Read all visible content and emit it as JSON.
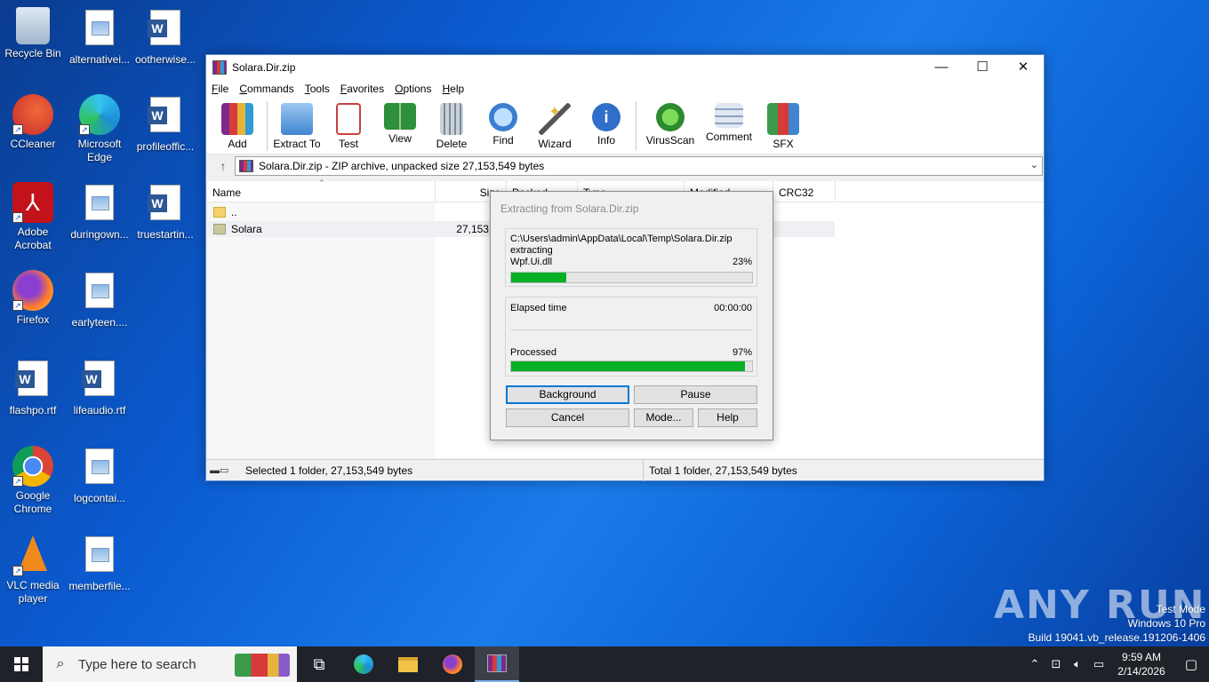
{
  "desktop": {
    "icons": [
      {
        "label": "Recycle Bin"
      },
      {
        "label": "alternativei..."
      },
      {
        "label": "ootherwise..."
      },
      {
        "label": "CCleaner"
      },
      {
        "label": "Microsoft Edge"
      },
      {
        "label": "profileoffic..."
      },
      {
        "label": "Adobe Acrobat"
      },
      {
        "label": "duringown..."
      },
      {
        "label": "truestartin..."
      },
      {
        "label": "Firefox"
      },
      {
        "label": "earlyteen...."
      },
      {
        "label": "flashpo.rtf"
      },
      {
        "label": "lifeaudio.rtf"
      },
      {
        "label": "Google Chrome"
      },
      {
        "label": "logcontai..."
      },
      {
        "label": "VLC media player"
      },
      {
        "label": "memberfile..."
      }
    ]
  },
  "window": {
    "title": "Solara.Dir.zip",
    "controls": {
      "minimize": "—",
      "maximize": "☐",
      "close": "✕"
    },
    "menu": [
      "File",
      "Commands",
      "Tools",
      "Favorites",
      "Options",
      "Help"
    ],
    "toolbar": [
      {
        "label": "Add",
        "icon": "add-archive-icon",
        "color": "#c23b3b"
      },
      {
        "label": "Extract To",
        "icon": "extract-folder-icon",
        "color": "#4a90d9"
      },
      {
        "label": "Test",
        "icon": "test-clipboard-icon",
        "color": "#d04040"
      },
      {
        "label": "View",
        "icon": "view-book-icon",
        "color": "#2f8f3a"
      },
      {
        "label": "Delete",
        "icon": "trash-icon",
        "color": "#7d8a96"
      },
      {
        "label": "Find",
        "icon": "magnifier-icon",
        "color": "#3a7fcf"
      },
      {
        "label": "Wizard",
        "icon": "wand-icon",
        "color": "#9b59b6"
      },
      {
        "label": "Info",
        "icon": "info-icon",
        "color": "#2f6fc9"
      },
      {
        "label": "VirusScan",
        "icon": "virus-icon",
        "color": "#3aa63a"
      },
      {
        "label": "Comment",
        "icon": "comment-icon",
        "color": "#8aa3c2"
      },
      {
        "label": "SFX",
        "icon": "sfx-icon",
        "color": "#d9892b"
      }
    ],
    "address": "Solara.Dir.zip - ZIP archive, unpacked size 27,153,549 bytes",
    "columns": [
      "Name",
      "Size",
      "Packed",
      "Type",
      "Modified",
      "CRC32"
    ],
    "rows": [
      {
        "name": "..",
        "size": ""
      },
      {
        "name": "Solara",
        "size": "27,153,5"
      }
    ],
    "status": {
      "selected": "Selected 1 folder, 27,153,549 bytes",
      "total": "Total 1 folder, 27,153,549 bytes"
    }
  },
  "dialog": {
    "title": "Extracting from Solara.Dir.zip",
    "path": "C:\\Users\\admin\\AppData\\Local\\Temp\\Solara.Dir.zip",
    "action": "extracting",
    "file": "Wpf.Ui.dll",
    "file_percent_label": "23%",
    "file_progress": 0.23,
    "elapsed_label": "Elapsed time",
    "elapsed_value": "00:00:00",
    "processed_label": "Processed",
    "processed_percent_label": "97%",
    "processed_progress": 0.97,
    "buttons": {
      "background": "Background",
      "pause": "Pause",
      "cancel": "Cancel",
      "mode": "Mode...",
      "help": "Help"
    }
  },
  "taskbar": {
    "search_placeholder": "Type here to search",
    "time": "9:59 AM",
    "date": "2/14/2026"
  },
  "watermark": {
    "line1": "Test Mode",
    "line2": "Windows 10 Pro",
    "line3": "Build 19041.vb_release.191206-1406",
    "brand": "ANY RUN"
  }
}
